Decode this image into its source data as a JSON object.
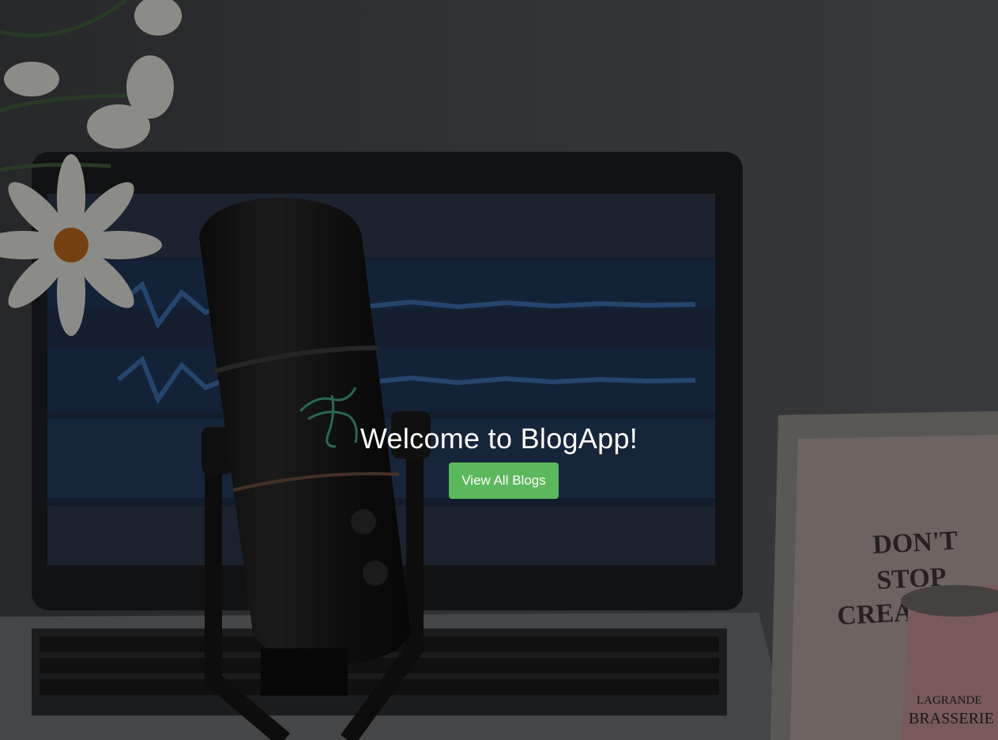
{
  "hero": {
    "title": "Welcome to BlogApp!",
    "button_label": "View All Blogs",
    "button_color": "#5cb85c"
  },
  "background": {
    "icon": "podcast-desk-photo",
    "mug_text_line1": "LAGRANDE",
    "mug_text_line2": "BRASSERIE",
    "frame_text_line1": "DON'T",
    "frame_text_line2": "STOP",
    "frame_text_line3": "CREA"
  }
}
